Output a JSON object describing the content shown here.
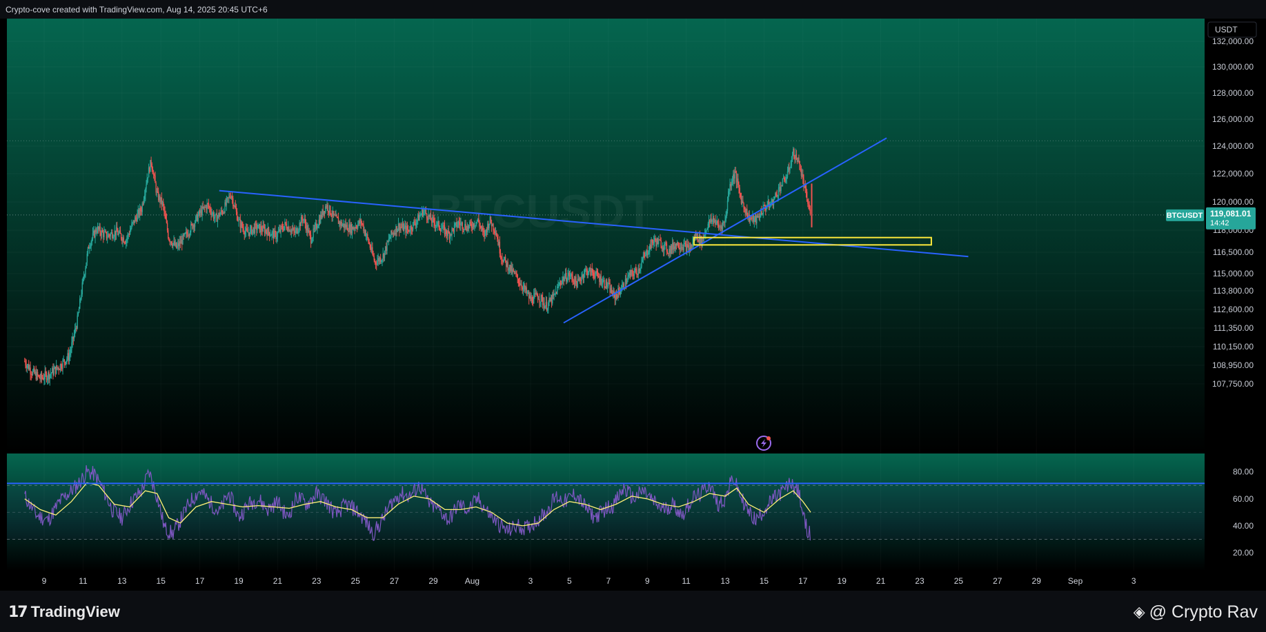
{
  "header": {
    "credit": "Crypto-cove created with TradingView.com, Aug 14, 2025 20:45 UTC+6"
  },
  "chart_data": {
    "type": "candlestick",
    "symbol_watermark": "BTCUSDT",
    "currency_label": "USDT",
    "price_badge": {
      "symbol": "BTCUSDT",
      "price": "119,081.01",
      "countdown": "14:42",
      "value": 119081.01
    },
    "y_ticks": [
      {
        "label": "132,000.00",
        "value": 132000
      },
      {
        "label": "130,000.00",
        "value": 130000
      },
      {
        "label": "128,000.00",
        "value": 128000
      },
      {
        "label": "126,000.00",
        "value": 126000
      },
      {
        "label": "124,000.00",
        "value": 124000
      },
      {
        "label": "122,000.00",
        "value": 122000
      },
      {
        "label": "120,000.00",
        "value": 120000
      },
      {
        "label": "118,000.00",
        "value": 118000
      },
      {
        "label": "116,500.00",
        "value": 116500
      },
      {
        "label": "115,000.00",
        "value": 115000
      },
      {
        "label": "113,800.00",
        "value": 113800
      },
      {
        "label": "112,600.00",
        "value": 112600
      },
      {
        "label": "111,350.00",
        "value": 111350
      },
      {
        "label": "110,150.00",
        "value": 110150
      },
      {
        "label": "108,950.00",
        "value": 108950
      },
      {
        "label": "107,750.00",
        "value": 107750
      }
    ],
    "x_ticks": [
      "9",
      "11",
      "13",
      "15",
      "17",
      "19",
      "21",
      "23",
      "25",
      "27",
      "29",
      "Aug",
      "3",
      "5",
      "7",
      "9",
      "11",
      "13",
      "15",
      "17",
      "19",
      "21",
      "23",
      "25",
      "27",
      "29",
      "Sep",
      "3"
    ],
    "last_high_level": 124400,
    "price_path": [
      [
        8.0,
        109200
      ],
      [
        8.4,
        108500
      ],
      [
        8.8,
        108100
      ],
      [
        9.3,
        108400
      ],
      [
        9.8,
        108900
      ],
      [
        10.3,
        109600
      ],
      [
        10.7,
        111800
      ],
      [
        11.0,
        114500
      ],
      [
        11.3,
        117000
      ],
      [
        11.7,
        118100
      ],
      [
        12.2,
        117600
      ],
      [
        12.7,
        117900
      ],
      [
        13.2,
        117300
      ],
      [
        13.6,
        118600
      ],
      [
        14.0,
        119500
      ],
      [
        14.3,
        121800
      ],
      [
        14.5,
        122900
      ],
      [
        14.8,
        120500
      ],
      [
        15.1,
        119800
      ],
      [
        15.4,
        117500
      ],
      [
        15.8,
        116800
      ],
      [
        16.2,
        117500
      ],
      [
        16.6,
        118300
      ],
      [
        17.0,
        119200
      ],
      [
        17.4,
        119800
      ],
      [
        17.8,
        118800
      ],
      [
        18.2,
        119400
      ],
      [
        18.6,
        120600
      ],
      [
        19.0,
        118600
      ],
      [
        19.4,
        117800
      ],
      [
        19.9,
        118200
      ],
      [
        20.4,
        118000
      ],
      [
        20.9,
        117600
      ],
      [
        21.4,
        118400
      ],
      [
        21.9,
        117800
      ],
      [
        22.3,
        118900
      ],
      [
        22.7,
        117400
      ],
      [
        23.1,
        118600
      ],
      [
        23.5,
        119800
      ],
      [
        23.9,
        118900
      ],
      [
        24.3,
        118400
      ],
      [
        24.8,
        118100
      ],
      [
        25.3,
        118600
      ],
      [
        25.7,
        117100
      ],
      [
        26.0,
        115800
      ],
      [
        26.4,
        116200
      ],
      [
        26.8,
        117600
      ],
      [
        27.2,
        118300
      ],
      [
        27.7,
        118000
      ],
      [
        28.1,
        118600
      ],
      [
        28.5,
        119400
      ],
      [
        28.9,
        118700
      ],
      [
        29.3,
        118300
      ],
      [
        29.8,
        117700
      ],
      [
        30.3,
        118500
      ],
      [
        30.8,
        118200
      ],
      [
        31.3,
        118700
      ],
      [
        31.6,
        117600
      ],
      [
        31.9,
        118700
      ],
      [
        32.2,
        118000
      ],
      [
        32.5,
        116200
      ],
      [
        32.8,
        115600
      ],
      [
        33.2,
        114900
      ],
      [
        33.6,
        114100
      ],
      [
        34.0,
        113200
      ],
      [
        34.4,
        113500
      ],
      [
        34.8,
        112800
      ],
      [
        35.2,
        113400
      ],
      [
        35.6,
        114600
      ],
      [
        36.0,
        114900
      ],
      [
        36.4,
        114300
      ],
      [
        36.8,
        115200
      ],
      [
        37.2,
        115100
      ],
      [
        37.6,
        114600
      ],
      [
        38.0,
        114100
      ],
      [
        38.3,
        113400
      ],
      [
        38.7,
        114000
      ],
      [
        39.1,
        114900
      ],
      [
        39.5,
        115200
      ],
      [
        39.9,
        116300
      ],
      [
        40.3,
        117300
      ],
      [
        40.7,
        117100
      ],
      [
        41.1,
        116600
      ],
      [
        41.5,
        117100
      ],
      [
        41.9,
        116900
      ],
      [
        42.2,
        116700
      ],
      [
        42.5,
        117700
      ],
      [
        42.8,
        117200
      ],
      [
        43.1,
        118400
      ],
      [
        43.4,
        118800
      ],
      [
        43.7,
        118200
      ],
      [
        44.0,
        118600
      ],
      [
        44.2,
        121000
      ],
      [
        44.5,
        122100
      ],
      [
        44.8,
        120300
      ],
      [
        45.2,
        118900
      ],
      [
        45.6,
        118700
      ],
      [
        46.0,
        119600
      ],
      [
        46.4,
        119900
      ],
      [
        46.8,
        121000
      ],
      [
        47.2,
        121900
      ],
      [
        47.5,
        123500
      ],
      [
        47.8,
        122800
      ],
      [
        48.0,
        121500
      ],
      [
        48.2,
        120200
      ],
      [
        48.4,
        119081
      ]
    ],
    "rsi": {
      "ticks": [
        {
          "label": "80.00",
          "value": 80
        },
        {
          "label": "60.00",
          "value": 60
        },
        {
          "label": "40.00",
          "value": 40
        },
        {
          "label": "20.00",
          "value": 20
        }
      ],
      "upper_band": 70,
      "mid_band": 50,
      "lower_band": 30,
      "rsi_path": [
        [
          8.0,
          62
        ],
        [
          8.6,
          48
        ],
        [
          9.2,
          44
        ],
        [
          9.8,
          58
        ],
        [
          10.4,
          66
        ],
        [
          10.8,
          72
        ],
        [
          11.2,
          80
        ],
        [
          11.6,
          78
        ],
        [
          12.0,
          68
        ],
        [
          12.5,
          52
        ],
        [
          13.0,
          46
        ],
        [
          13.5,
          58
        ],
        [
          14.0,
          66
        ],
        [
          14.4,
          80
        ],
        [
          14.8,
          62
        ],
        [
          15.2,
          38
        ],
        [
          15.6,
          34
        ],
        [
          16.0,
          44
        ],
        [
          16.5,
          58
        ],
        [
          17.0,
          66
        ],
        [
          17.5,
          58
        ],
        [
          18.0,
          50
        ],
        [
          18.5,
          64
        ],
        [
          19.0,
          46
        ],
        [
          19.5,
          56
        ],
        [
          20.0,
          60
        ],
        [
          20.5,
          52
        ],
        [
          21.0,
          58
        ],
        [
          21.5,
          46
        ],
        [
          22.0,
          62
        ],
        [
          22.5,
          56
        ],
        [
          23.0,
          64
        ],
        [
          23.5,
          58
        ],
        [
          24.0,
          48
        ],
        [
          24.5,
          56
        ],
        [
          25.0,
          52
        ],
        [
          25.5,
          44
        ],
        [
          25.9,
          34
        ],
        [
          26.3,
          42
        ],
        [
          26.8,
          56
        ],
        [
          27.3,
          64
        ],
        [
          27.8,
          62
        ],
        [
          28.3,
          70
        ],
        [
          28.8,
          56
        ],
        [
          29.3,
          52
        ],
        [
          29.8,
          44
        ],
        [
          30.3,
          56
        ],
        [
          30.8,
          52
        ],
        [
          31.3,
          60
        ],
        [
          31.8,
          50
        ],
        [
          32.3,
          42
        ],
        [
          32.8,
          36
        ],
        [
          33.3,
          40
        ],
        [
          33.8,
          38
        ],
        [
          34.3,
          44
        ],
        [
          34.8,
          50
        ],
        [
          35.3,
          62
        ],
        [
          35.8,
          58
        ],
        [
          36.3,
          64
        ],
        [
          36.8,
          54
        ],
        [
          37.3,
          46
        ],
        [
          37.8,
          52
        ],
        [
          38.3,
          56
        ],
        [
          38.8,
          68
        ],
        [
          39.3,
          60
        ],
        [
          39.8,
          66
        ],
        [
          40.3,
          58
        ],
        [
          40.8,
          52
        ],
        [
          41.3,
          56
        ],
        [
          41.8,
          48
        ],
        [
          42.3,
          60
        ],
        [
          42.8,
          64
        ],
        [
          43.2,
          72
        ],
        [
          43.6,
          56
        ],
        [
          44.0,
          60
        ],
        [
          44.4,
          76
        ],
        [
          44.8,
          62
        ],
        [
          45.2,
          50
        ],
        [
          45.6,
          44
        ],
        [
          46.0,
          52
        ],
        [
          46.5,
          60
        ],
        [
          47.0,
          66
        ],
        [
          47.4,
          72
        ],
        [
          47.8,
          64
        ],
        [
          48.1,
          42
        ],
        [
          48.4,
          32
        ]
      ],
      "ma_path": [
        [
          8.0,
          60
        ],
        [
          8.8,
          52
        ],
        [
          9.6,
          48
        ],
        [
          10.4,
          58
        ],
        [
          11.2,
          72
        ],
        [
          11.8,
          70
        ],
        [
          12.6,
          56
        ],
        [
          13.4,
          54
        ],
        [
          14.2,
          66
        ],
        [
          14.8,
          64
        ],
        [
          15.4,
          46
        ],
        [
          16.0,
          42
        ],
        [
          16.8,
          54
        ],
        [
          17.6,
          58
        ],
        [
          18.4,
          56
        ],
        [
          19.2,
          54
        ],
        [
          20.0,
          55
        ],
        [
          20.8,
          54
        ],
        [
          21.6,
          53
        ],
        [
          22.4,
          56
        ],
        [
          23.2,
          58
        ],
        [
          24.0,
          54
        ],
        [
          24.8,
          52
        ],
        [
          25.6,
          46
        ],
        [
          26.4,
          46
        ],
        [
          27.2,
          56
        ],
        [
          28.0,
          62
        ],
        [
          28.8,
          60
        ],
        [
          29.6,
          52
        ],
        [
          30.4,
          52
        ],
        [
          31.2,
          54
        ],
        [
          32.0,
          50
        ],
        [
          32.8,
          42
        ],
        [
          33.6,
          40
        ],
        [
          34.4,
          42
        ],
        [
          35.2,
          52
        ],
        [
          36.0,
          58
        ],
        [
          36.8,
          56
        ],
        [
          37.6,
          52
        ],
        [
          38.4,
          56
        ],
        [
          39.2,
          62
        ],
        [
          40.0,
          60
        ],
        [
          40.8,
          56
        ],
        [
          41.6,
          54
        ],
        [
          42.4,
          58
        ],
        [
          43.2,
          64
        ],
        [
          44.0,
          62
        ],
        [
          44.6,
          68
        ],
        [
          45.2,
          56
        ],
        [
          46.0,
          50
        ],
        [
          46.8,
          60
        ],
        [
          47.5,
          66
        ],
        [
          48.0,
          58
        ],
        [
          48.4,
          50
        ]
      ]
    },
    "drawings": {
      "descending_trendline": [
        [
          18.0,
          120800
        ],
        [
          56.5,
          116200
        ]
      ],
      "ascending_trendline": [
        [
          35.7,
          111700
        ],
        [
          52.3,
          124600
        ]
      ],
      "support_zone": {
        "x0": 42.4,
        "x1": 54.6,
        "y0": 117000,
        "y1": 117500
      },
      "rsi_trendline": [
        [
          8.0,
          71.5
        ],
        [
          62.0,
          71.5
        ]
      ]
    }
  },
  "footer": {
    "logo_mark": "17",
    "logo_text": "TradingView",
    "author_glyph": "◈",
    "author": "@ Crypto Rav"
  },
  "colors": {
    "up": "#26a69a",
    "down": "#ef5350",
    "trend": "#2962ff",
    "zone": "#ffeb3b",
    "rsi": "#7e57c2",
    "rsi_ma": "#fff176"
  }
}
